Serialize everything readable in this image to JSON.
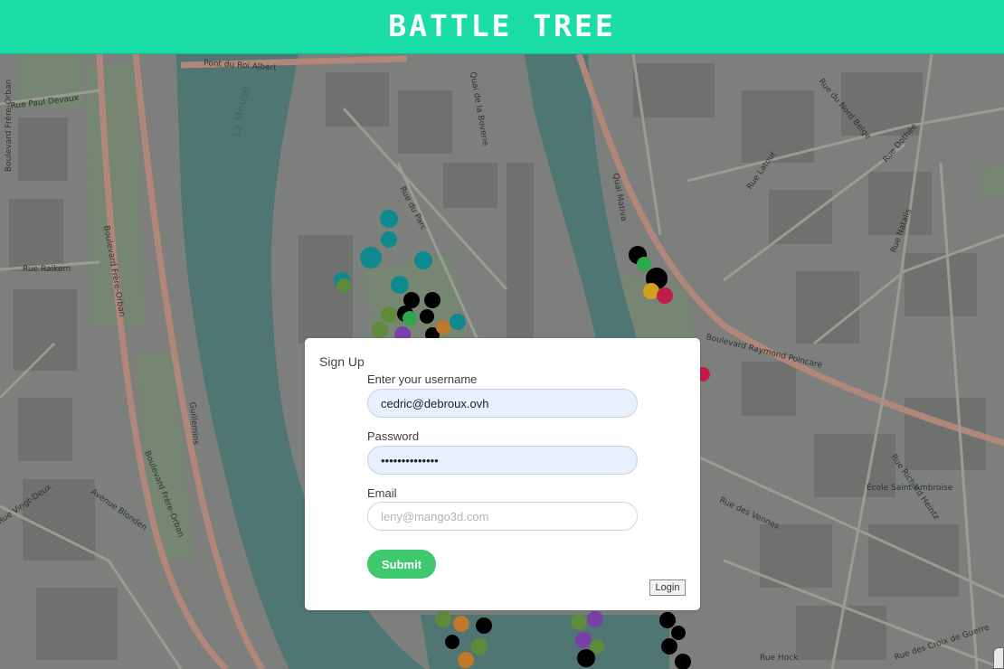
{
  "header": {
    "title": "BATTLE TREE"
  },
  "map": {
    "labels": {
      "pont_roi_albert": "Pont du Roi Albert",
      "quai_boverie": "Quai de la Boverie",
      "la_meuse": "La Meuse",
      "rue_paul_devaux": "Rue Paul Devaux",
      "rue_raikem": "Rue Raikem",
      "bd_frere_orban_1": "Boulevard Frère-Orban",
      "bd_frere_orban_2": "Boulevard Frère-Orban",
      "bd_frere_orban_3": "Boulevard Frère-Orban",
      "rue_du_parc": "Rue du Parc",
      "rue_latour": "Rue Latour",
      "rue_dothee": "Rue Dothée",
      "rue_natalis": "Rue Natalis",
      "bd_raymond_poincare": "Boulevard Raymond Poincaré",
      "avenue_blonden": "Avenue Blonden",
      "rue_vingt_deux": "Rue Vingt-Deux",
      "rue_des_vennes": "Rue des Vennes",
      "rue_richard_heintz": "Rue Richard Heintz",
      "rue_croix_de_guerre": "Rue des Croix de Guerre",
      "rue_hock": "Rue Hock",
      "ecole": "École Saint Ambroise",
      "guillemins": "Guillemins",
      "rue_nord_belge": "Rue du Nord Belge",
      "quai_mativa": "Quai Mativa"
    }
  },
  "signup": {
    "title": "Sign Up",
    "username_label": "Enter your username",
    "username_value": "cedric@debroux.ovh",
    "password_label": "Password",
    "password_value": "••••••••••••••",
    "email_label": "Email",
    "email_placeholder": "leny@mango3d.com",
    "submit_label": "Submit",
    "login_label": "Login"
  },
  "colors": {
    "header": "#1adca6",
    "submit": "#3fc96f",
    "input_filled": "#e8f0fe",
    "river": "#4f7673"
  }
}
